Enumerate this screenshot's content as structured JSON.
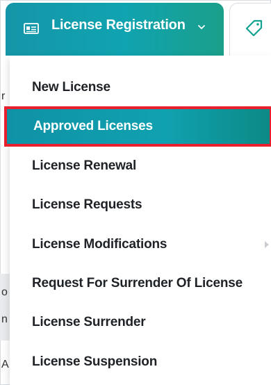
{
  "colors": {
    "accent_teal": "#10a1b0",
    "highlight_border": "#e8202d",
    "menu_text": "#1e2226"
  },
  "tabs": {
    "license_registration": {
      "label": "License Registration",
      "icon": "id-card-icon",
      "expand_icon": "chevron-down-icon"
    },
    "next_tab": {
      "icon": "tag-icon"
    }
  },
  "menu": {
    "items": [
      {
        "label": "New License",
        "active": false
      },
      {
        "label": "Approved Licenses",
        "active": true
      },
      {
        "label": "License Renewal",
        "active": false
      },
      {
        "label": "License Requests",
        "active": false
      },
      {
        "label": "License Modifications",
        "active": false,
        "has_submenu": true
      },
      {
        "label": "Request For Surrender Of License",
        "active": false
      },
      {
        "label": "License Surrender",
        "active": false
      },
      {
        "label": "License Suspension",
        "active": false
      }
    ]
  },
  "background": {
    "fragments": [
      "r",
      "o",
      "n",
      "A"
    ]
  }
}
